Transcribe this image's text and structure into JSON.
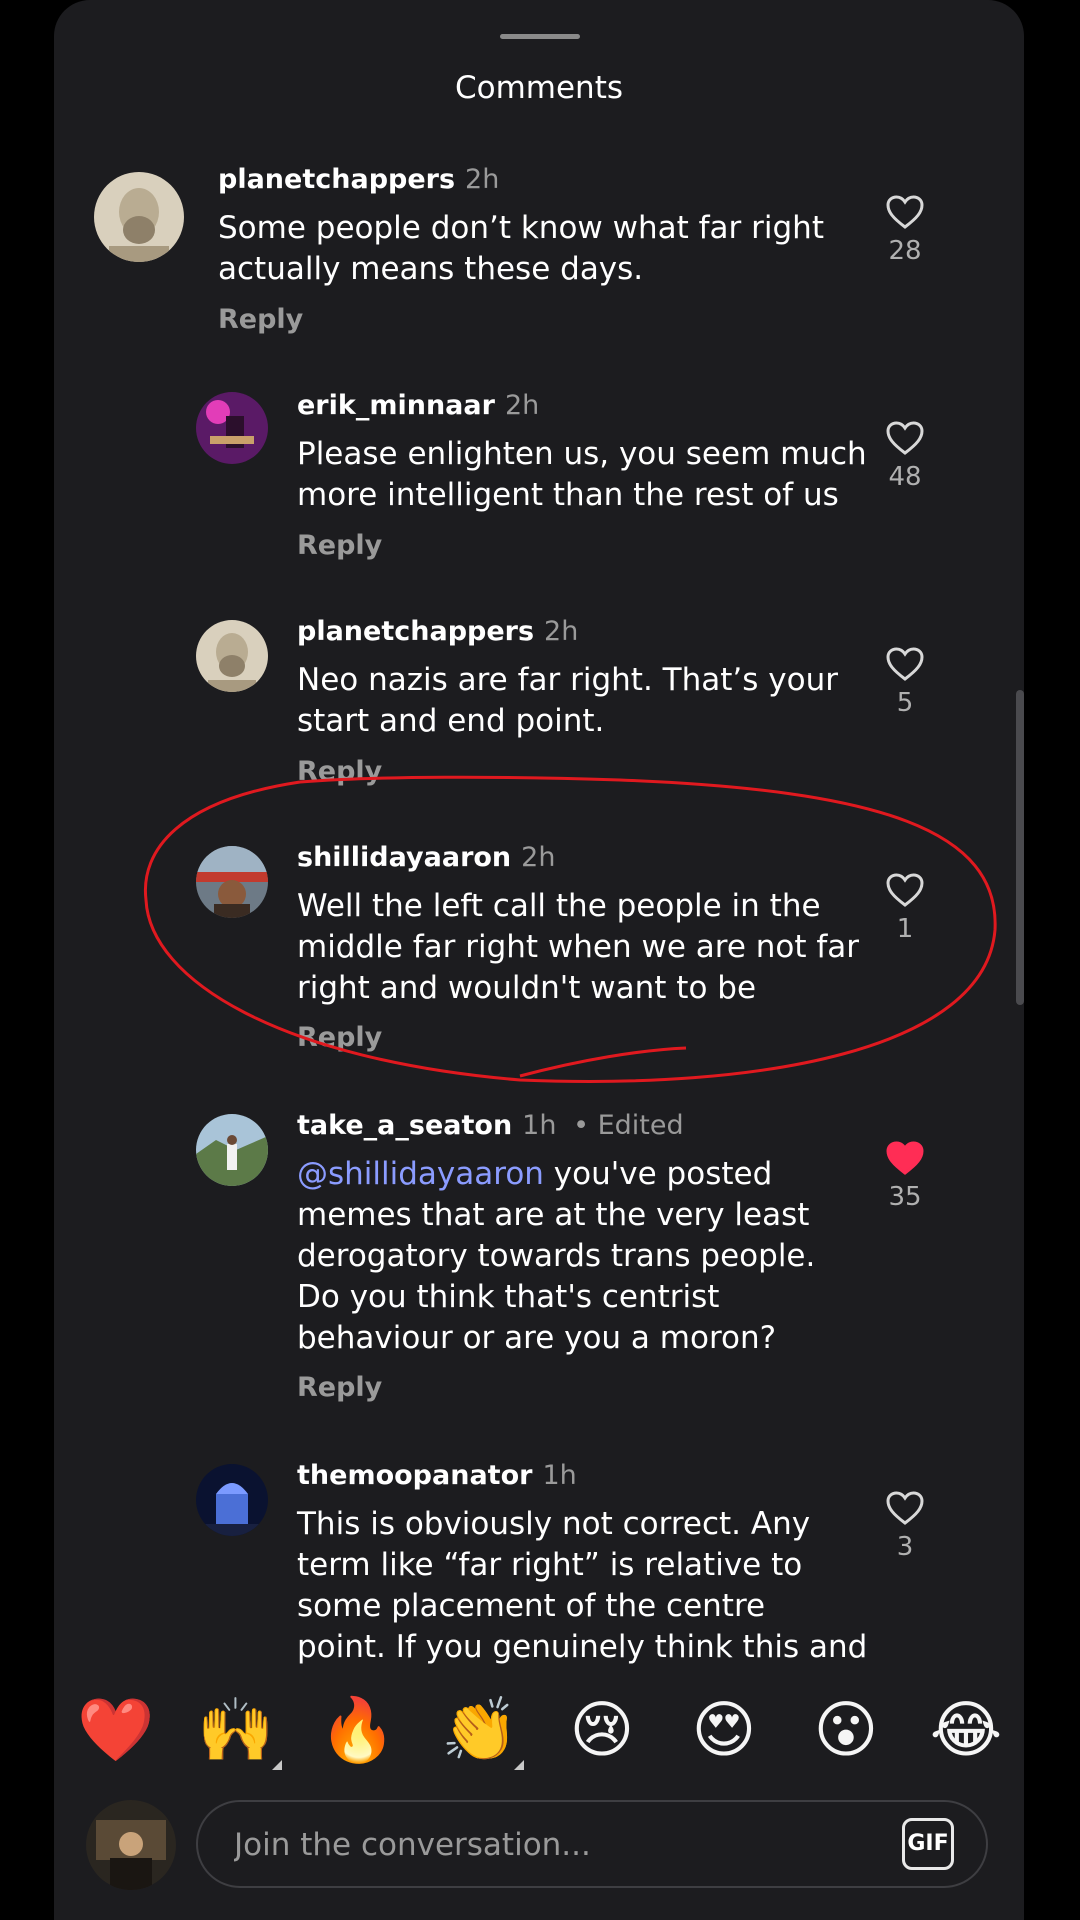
{
  "sheet": {
    "title": "Comments"
  },
  "comments": [
    {
      "username": "planetchappers",
      "time": "2h",
      "text": "Some people don’t know what far right\nactually means these days.",
      "reply": "Reply",
      "likes": "28",
      "liked": false,
      "avatar": "portrait-sketch-avatar"
    },
    {
      "username": "erik_minnaar",
      "time": "2h",
      "text": "Please enlighten us, you seem much\nmore intelligent than the rest of us",
      "reply": "Reply",
      "likes": "48",
      "liked": false,
      "avatar": "guitarist-avatar"
    },
    {
      "username": "planetchappers",
      "time": "2h",
      "text": "Neo nazis are far right. That’s your\nstart and end point.",
      "reply": "Reply",
      "likes": "5",
      "liked": false,
      "avatar": "portrait-sketch-avatar"
    },
    {
      "username": "shillidayaaron",
      "time": "2h",
      "text": "Well the left call the people in the\nmiddle far right when we are not far\nright and wouldn't want to be",
      "reply": "Reply",
      "likes": "1",
      "liked": false,
      "avatar": "stadium-avatar"
    },
    {
      "username": "take_a_seaton",
      "time": "1h",
      "edited": "• Edited",
      "mention": "@shillidayaaron",
      "text": " you've posted\nmemes that are at the very least\nderogatory towards trans people.\nDo you think that's centrist\nbehaviour or are you a moron?",
      "reply": "Reply",
      "likes": "35",
      "liked": true,
      "avatar": "landscape-avatar"
    },
    {
      "username": "themoopanator",
      "time": "1h",
      "text": "This is obviously not correct. Any\nterm like “far right” is relative to\nsome placement of the centre\npoint. If you genuinely think this and",
      "likes": "3",
      "liked": false,
      "avatar": "night-building-avatar"
    }
  ],
  "emoji_bar": {
    "emojis": [
      "❤️",
      "🙌",
      "🔥",
      "👏",
      "😢",
      "😍",
      "😮",
      "😂"
    ]
  },
  "composer": {
    "placeholder": "Join the conversation...",
    "gif_label": "GIF"
  },
  "colors": {
    "sheet_bg": "#1c1c1f",
    "liked_heart": "#ff2d55",
    "mention": "#8b9cff",
    "annotation_circle": "#e0191f"
  },
  "icons": {
    "like": "heart-outline-icon",
    "liked": "heart-filled-icon",
    "gif": "gif-icon"
  }
}
